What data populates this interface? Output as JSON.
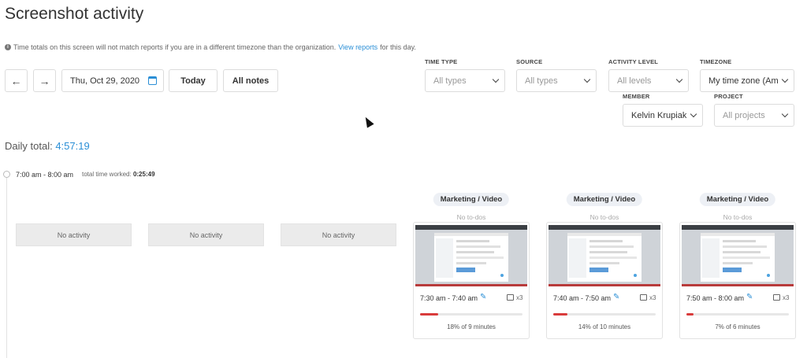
{
  "page": {
    "title": "Screenshot activity",
    "note_text": "Time totals on this screen will not match reports if you are in a different timezone than the organization.",
    "note_link": "View reports",
    "note_suffix": "for this day."
  },
  "controls": {
    "date": "Thu, Oct 29, 2020",
    "today": "Today",
    "all_notes": "All notes",
    "prev_icon": "arrow-left-icon",
    "next_icon": "arrow-right-icon"
  },
  "filters": {
    "time_type": {
      "label": "TIME TYPE",
      "value": "All types"
    },
    "source": {
      "label": "SOURCE",
      "value": "All types"
    },
    "activity_level": {
      "label": "ACTIVITY LEVEL",
      "value": "All levels"
    },
    "timezone": {
      "label": "TIMEZONE",
      "value": "My time zone (America"
    },
    "member": {
      "label": "MEMBER",
      "value": "Kelvin Krupiak"
    },
    "project": {
      "label": "PROJECT",
      "value": "All projects"
    }
  },
  "daily_total": {
    "label": "Daily total:",
    "value": "4:57:19"
  },
  "timeslot": {
    "range": "7:00 am - 8:00 am",
    "worked_label": "total time worked:",
    "worked_value": "0:25:49"
  },
  "no_activity_label": "No activity",
  "cards": [
    {
      "project": "Marketing / Video",
      "todo": "No to-dos",
      "time": "7:30 am - 7:40 am",
      "count": "x3",
      "progress": 0.18,
      "percent_text": "18% of 9 minutes"
    },
    {
      "project": "Marketing / Video",
      "todo": "No to-dos",
      "time": "7:40 am - 7:50 am",
      "count": "x3",
      "progress": 0.14,
      "percent_text": "14% of 10 minutes"
    },
    {
      "project": "Marketing / Video",
      "todo": "No to-dos",
      "time": "7:50 am - 8:00 am",
      "count": "x3",
      "progress": 0.07,
      "percent_text": "7% of 6 minutes"
    }
  ],
  "colors": {
    "accent": "#2b8fd6",
    "progress_red": "#d93b3b"
  }
}
